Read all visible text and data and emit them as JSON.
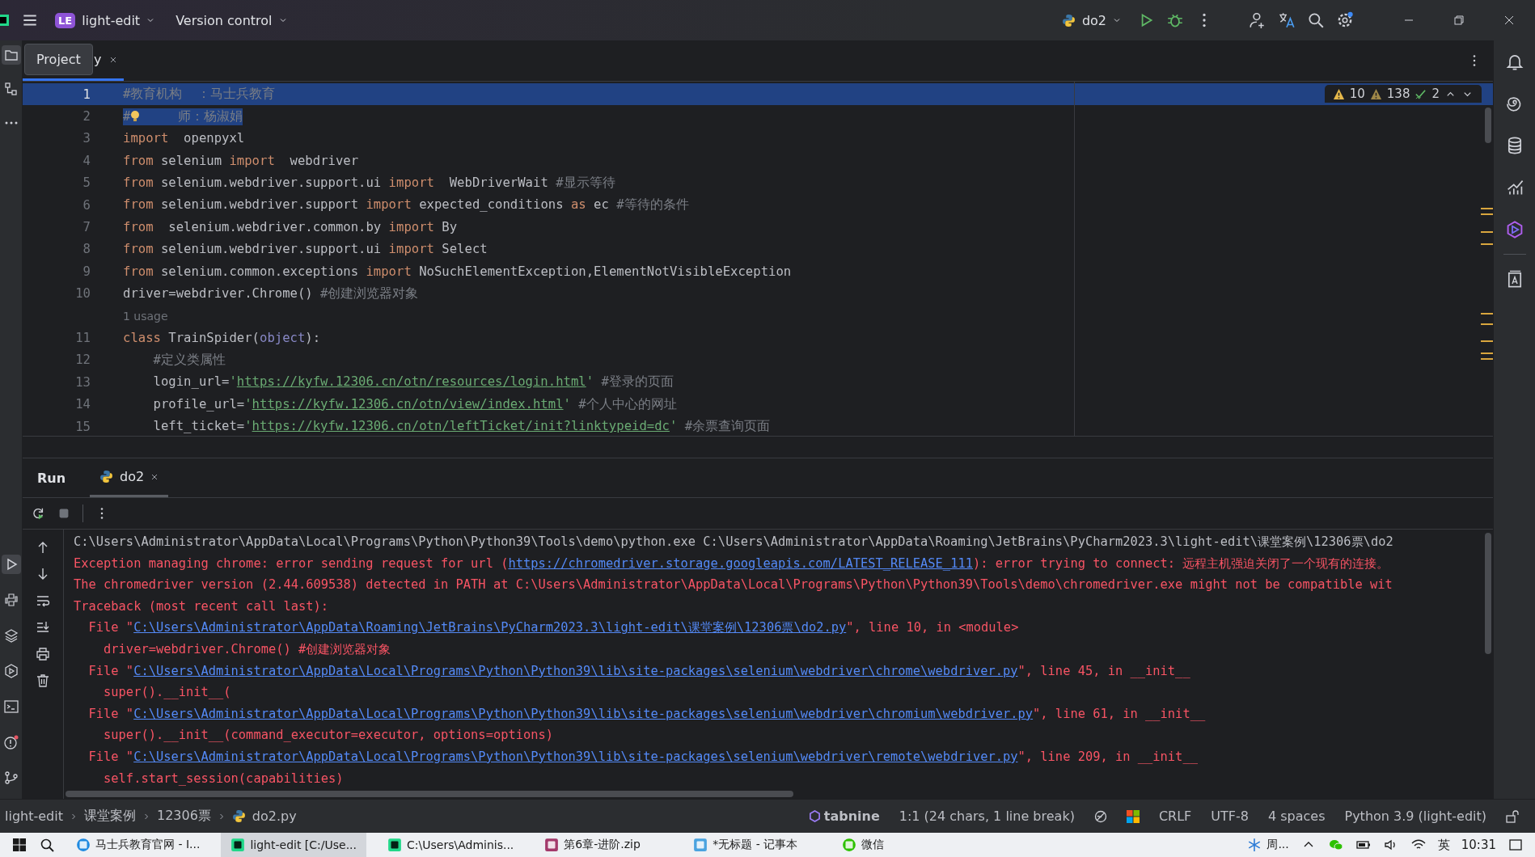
{
  "title_bar": {
    "project_badge": "LE",
    "project_name": "light-edit",
    "vcs": "Version control",
    "run_config": "do2"
  },
  "editor": {
    "tab": {
      "label": "y",
      "selected": true
    },
    "tooltip": "Project",
    "inspections": {
      "warnings": "10",
      "weak_warnings": "138",
      "typos": "2"
    },
    "lines": [
      {
        "kind": "code",
        "number": "1",
        "current": true,
        "selection": true,
        "tokens": [
          {
            "kind": "comment",
            "text": "#教育机构  ：马士兵教育"
          }
        ]
      },
      {
        "kind": "code",
        "number": "2",
        "current": false,
        "selection": true,
        "tokens": [
          {
            "kind": "comment",
            "text": "#"
          },
          {
            "kind": "bulb"
          },
          {
            "kind": "comment",
            "text": "     师：杨淑娟"
          }
        ]
      },
      {
        "kind": "code",
        "number": "3",
        "current": false,
        "selection": false,
        "tokens": [
          {
            "kind": "keyword",
            "text": "import"
          },
          {
            "kind": "plain",
            "text": "  openpyxl"
          }
        ]
      },
      {
        "kind": "code",
        "number": "4",
        "current": false,
        "selection": false,
        "tokens": [
          {
            "kind": "keyword",
            "text": "from"
          },
          {
            "kind": "plain",
            "text": " selenium "
          },
          {
            "kind": "keyword",
            "text": "import"
          },
          {
            "kind": "plain",
            "text": "  webdriver"
          }
        ]
      },
      {
        "kind": "code",
        "number": "5",
        "current": false,
        "selection": false,
        "tokens": [
          {
            "kind": "keyword",
            "text": "from"
          },
          {
            "kind": "plain",
            "text": " selenium.webdriver.support.ui "
          },
          {
            "kind": "keyword",
            "text": "import"
          },
          {
            "kind": "plain",
            "text": "  WebDriverWait "
          },
          {
            "kind": "comment",
            "text": "#显示等待"
          }
        ]
      },
      {
        "kind": "code",
        "number": "6",
        "current": false,
        "selection": false,
        "tokens": [
          {
            "kind": "keyword",
            "text": "from"
          },
          {
            "kind": "plain",
            "text": " selenium.webdriver.support "
          },
          {
            "kind": "keyword",
            "text": "import"
          },
          {
            "kind": "plain",
            "text": " expected_conditions "
          },
          {
            "kind": "keyword",
            "text": "as"
          },
          {
            "kind": "plain",
            "text": " ec "
          },
          {
            "kind": "comment",
            "text": "#等待的条件"
          }
        ]
      },
      {
        "kind": "code",
        "number": "7",
        "current": false,
        "selection": false,
        "tokens": [
          {
            "kind": "keyword",
            "text": "from"
          },
          {
            "kind": "plain",
            "text": "  selenium.webdriver.common.by "
          },
          {
            "kind": "keyword",
            "text": "import"
          },
          {
            "kind": "plain",
            "text": " By"
          }
        ]
      },
      {
        "kind": "code",
        "number": "8",
        "current": false,
        "selection": false,
        "tokens": [
          {
            "kind": "keyword",
            "text": "from"
          },
          {
            "kind": "plain",
            "text": " selenium.webdriver.support.ui "
          },
          {
            "kind": "keyword",
            "text": "import"
          },
          {
            "kind": "plain",
            "text": " Select"
          }
        ]
      },
      {
        "kind": "code",
        "number": "9",
        "current": false,
        "selection": false,
        "tokens": [
          {
            "kind": "keyword",
            "text": "from"
          },
          {
            "kind": "plain",
            "text": " selenium.common.exceptions "
          },
          {
            "kind": "keyword",
            "text": "import"
          },
          {
            "kind": "plain",
            "text": " NoSuchElementException,ElementNotVisibleException"
          }
        ]
      },
      {
        "kind": "code",
        "number": "10",
        "current": false,
        "selection": false,
        "tokens": [
          {
            "kind": "plain",
            "text": "driver=webdriver.Chrome() "
          },
          {
            "kind": "comment",
            "text": "#创建浏览器对象"
          }
        ]
      },
      {
        "kind": "inlay",
        "text": "1 usage"
      },
      {
        "kind": "code",
        "number": "11",
        "current": false,
        "selection": false,
        "tokens": [
          {
            "kind": "keyword",
            "text": "class"
          },
          {
            "kind": "plain",
            "text": " TrainSpider("
          },
          {
            "kind": "builtin",
            "text": "object"
          },
          {
            "kind": "plain",
            "text": "):"
          }
        ]
      },
      {
        "kind": "code",
        "number": "12",
        "current": false,
        "selection": false,
        "tokens": [
          {
            "kind": "comment",
            "text": "    #定义类属性"
          }
        ]
      },
      {
        "kind": "code",
        "number": "13",
        "current": false,
        "selection": false,
        "tokens": [
          {
            "kind": "plain",
            "text": "    login_url="
          },
          {
            "kind": "string",
            "text": "'"
          },
          {
            "kind": "url",
            "text": "https://kyfw.12306.cn/otn/resources/login.html"
          },
          {
            "kind": "string",
            "text": "'"
          },
          {
            "kind": "comment",
            "text": " #登录的页面"
          }
        ]
      },
      {
        "kind": "code",
        "number": "14",
        "current": false,
        "selection": false,
        "tokens": [
          {
            "kind": "plain",
            "text": "    profile_url="
          },
          {
            "kind": "string",
            "text": "'"
          },
          {
            "kind": "url",
            "text": "https://kyfw.12306.cn/otn/view/index.html"
          },
          {
            "kind": "string",
            "text": "'"
          },
          {
            "kind": "comment",
            "text": " #个人中心的网址"
          }
        ]
      },
      {
        "kind": "code",
        "number": "15",
        "current": false,
        "selection": false,
        "tokens": [
          {
            "kind": "plain",
            "text": "    left_ticket="
          },
          {
            "kind": "string",
            "text": "'"
          },
          {
            "kind": "url",
            "text": "https://kyfw.12306.cn/otn/leftTicket/init?linktypeid=dc"
          },
          {
            "kind": "string",
            "text": "'"
          },
          {
            "kind": "comment",
            "text": " #余票查询页面"
          }
        ]
      }
    ]
  },
  "run_panel": {
    "title": "Run",
    "tab": {
      "label": "do2",
      "selected": true
    },
    "console": [
      {
        "kind": "normal",
        "parts": [
          {
            "text": "C:\\Users\\Administrator\\AppData\\Local\\Programs\\Python\\Python39\\Tools\\demo\\python.exe C:\\Users\\Administrator\\AppData\\Roaming\\JetBrains\\PyCharm2023.3\\light-edit\\课堂案例\\12306票\\do2",
            "link": false
          }
        ]
      },
      {
        "kind": "error",
        "parts": [
          {
            "text": "Exception managing chrome: error sending request for url (",
            "link": false
          },
          {
            "text": "https://chromedriver.storage.googleapis.com/LATEST_RELEASE_111",
            "link": true
          },
          {
            "text": "): error trying to connect: 远程主机强迫关闭了一个现有的连接。",
            "link": false
          }
        ]
      },
      {
        "kind": "error",
        "parts": [
          {
            "text": "The chromedriver version (2.44.609538) detected in PATH at C:\\Users\\Administrator\\AppData\\Local\\Programs\\Python\\Python39\\Tools\\demo\\chromedriver.exe might not be compatible wit",
            "link": false
          }
        ]
      },
      {
        "kind": "error",
        "parts": [
          {
            "text": "Traceback (most recent call last):",
            "link": false
          }
        ]
      },
      {
        "kind": "error",
        "parts": [
          {
            "text": "  File \"",
            "link": false
          },
          {
            "text": "C:\\Users\\Administrator\\AppData\\Roaming\\JetBrains\\PyCharm2023.3\\light-edit\\课堂案例\\12306票\\do2.py",
            "link": true
          },
          {
            "text": "\", line 10, in <module>",
            "link": false
          }
        ]
      },
      {
        "kind": "error",
        "parts": [
          {
            "text": "    driver=webdriver.Chrome() #创建浏览器对象",
            "link": false
          }
        ]
      },
      {
        "kind": "error",
        "parts": [
          {
            "text": "  File \"",
            "link": false
          },
          {
            "text": "C:\\Users\\Administrator\\AppData\\Local\\Programs\\Python\\Python39\\lib\\site-packages\\selenium\\webdriver\\chrome\\webdriver.py",
            "link": true
          },
          {
            "text": "\", line 45, in __init__",
            "link": false
          }
        ]
      },
      {
        "kind": "error",
        "parts": [
          {
            "text": "    super().__init__(",
            "link": false
          }
        ]
      },
      {
        "kind": "error",
        "parts": [
          {
            "text": "  File \"",
            "link": false
          },
          {
            "text": "C:\\Users\\Administrator\\AppData\\Local\\Programs\\Python\\Python39\\lib\\site-packages\\selenium\\webdriver\\chromium\\webdriver.py",
            "link": true
          },
          {
            "text": "\", line 61, in __init__",
            "link": false
          }
        ]
      },
      {
        "kind": "error",
        "parts": [
          {
            "text": "    super().__init__(command_executor=executor, options=options)",
            "link": false
          }
        ]
      },
      {
        "kind": "error",
        "parts": [
          {
            "text": "  File \"",
            "link": false
          },
          {
            "text": "C:\\Users\\Administrator\\AppData\\Local\\Programs\\Python\\Python39\\lib\\site-packages\\selenium\\webdriver\\remote\\webdriver.py",
            "link": true
          },
          {
            "text": "\", line 209, in __init__",
            "link": false
          }
        ]
      },
      {
        "kind": "error",
        "parts": [
          {
            "text": "    self.start_session(capabilities)",
            "link": false
          }
        ]
      }
    ]
  },
  "status_bar": {
    "breadcrumbs": [
      "light-edit",
      "课堂案例",
      "12306票",
      "do2.py"
    ],
    "plugin": "tabnine",
    "position": "1:1 (24 chars, 1 line break)",
    "line_separator": "CRLF",
    "encoding": "UTF-8",
    "indent": "4 spaces",
    "interpreter": "Python 3.9 (light-edit)"
  },
  "taskbar": {
    "apps": [
      {
        "label": "马士兵教育官网 - I...",
        "kind": "browser",
        "selected": false
      },
      {
        "label": "light-edit [C:/Use...",
        "kind": "pycharm",
        "selected": true
      },
      {
        "label": "C:\\Users\\Adminis...",
        "kind": "pycharm",
        "selected": false
      },
      {
        "label": "第6章-进阶.zip",
        "kind": "archive",
        "selected": false
      },
      {
        "label": "*无标题 - 记事本",
        "kind": "notepad",
        "selected": false
      },
      {
        "label": "微信",
        "kind": "chat",
        "selected": false
      }
    ],
    "weather": "周...",
    "ime": "英",
    "time": "10:31"
  }
}
